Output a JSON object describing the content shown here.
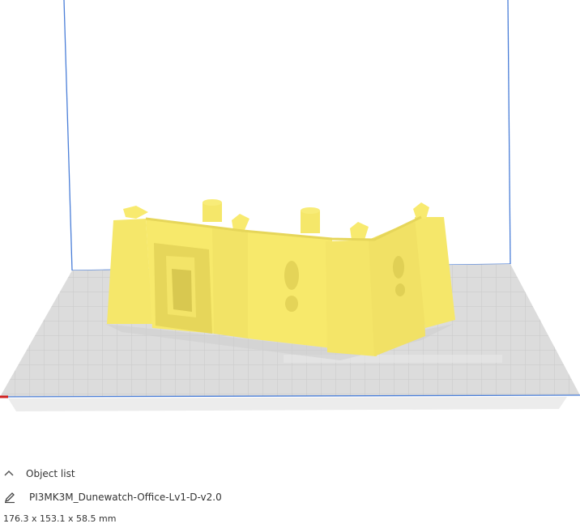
{
  "viewport": {
    "build_volume_edge_color": "#4a7ed8",
    "bed_color": "#dcdcdc",
    "grid_color": "#c7c7c7",
    "model_color": "#f7e96b",
    "model_shadow_color": "#d9c94a"
  },
  "object_list": {
    "toggle_label": "Object list",
    "toggle_icon": "chevron-up-icon"
  },
  "object": {
    "edit_icon": "pencil-icon",
    "name": "PI3MK3M_Dunewatch-Office-Lv1-D-v2.0",
    "dimensions": "176.3 x 153.1 x 58.5 mm"
  }
}
